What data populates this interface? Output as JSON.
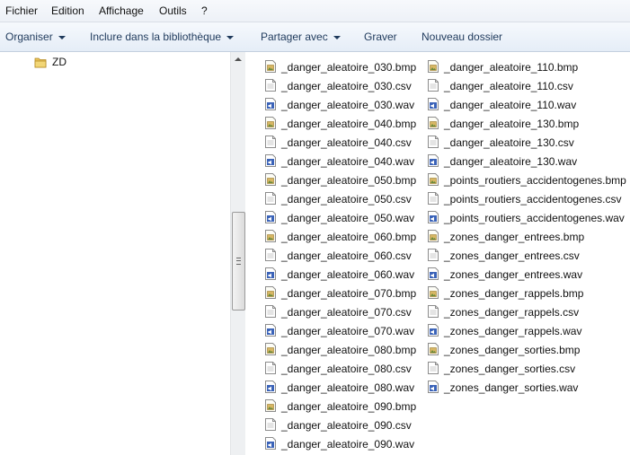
{
  "menubar": {
    "items": [
      "Fichier",
      "Edition",
      "Affichage",
      "Outils",
      "?"
    ]
  },
  "toolbar": {
    "organize": "Organiser",
    "include_library": "Inclure dans la bibliothèque",
    "share": "Partager avec",
    "burn": "Graver",
    "new_folder": "Nouveau dossier"
  },
  "nav": {
    "folder_label": "ZD"
  },
  "files": {
    "col1": [
      {
        "name": "_danger_aleatoire_030.bmp",
        "type": "bmp"
      },
      {
        "name": "_danger_aleatoire_030.csv",
        "type": "csv"
      },
      {
        "name": "_danger_aleatoire_030.wav",
        "type": "wav"
      },
      {
        "name": "_danger_aleatoire_040.bmp",
        "type": "bmp"
      },
      {
        "name": "_danger_aleatoire_040.csv",
        "type": "csv"
      },
      {
        "name": "_danger_aleatoire_040.wav",
        "type": "wav"
      },
      {
        "name": "_danger_aleatoire_050.bmp",
        "type": "bmp"
      },
      {
        "name": "_danger_aleatoire_050.csv",
        "type": "csv"
      },
      {
        "name": "_danger_aleatoire_050.wav",
        "type": "wav"
      },
      {
        "name": "_danger_aleatoire_060.bmp",
        "type": "bmp"
      },
      {
        "name": "_danger_aleatoire_060.csv",
        "type": "csv"
      },
      {
        "name": "_danger_aleatoire_060.wav",
        "type": "wav"
      },
      {
        "name": "_danger_aleatoire_070.bmp",
        "type": "bmp"
      },
      {
        "name": "_danger_aleatoire_070.csv",
        "type": "csv"
      },
      {
        "name": "_danger_aleatoire_070.wav",
        "type": "wav"
      },
      {
        "name": "_danger_aleatoire_080.bmp",
        "type": "bmp"
      },
      {
        "name": "_danger_aleatoire_080.csv",
        "type": "csv"
      },
      {
        "name": "_danger_aleatoire_080.wav",
        "type": "wav"
      },
      {
        "name": "_danger_aleatoire_090.bmp",
        "type": "bmp"
      },
      {
        "name": "_danger_aleatoire_090.csv",
        "type": "csv"
      },
      {
        "name": "_danger_aleatoire_090.wav",
        "type": "wav"
      }
    ],
    "col2": [
      {
        "name": "_danger_aleatoire_110.bmp",
        "type": "bmp"
      },
      {
        "name": "_danger_aleatoire_110.csv",
        "type": "csv"
      },
      {
        "name": "_danger_aleatoire_110.wav",
        "type": "wav"
      },
      {
        "name": "_danger_aleatoire_130.bmp",
        "type": "bmp"
      },
      {
        "name": "_danger_aleatoire_130.csv",
        "type": "csv"
      },
      {
        "name": "_danger_aleatoire_130.wav",
        "type": "wav"
      },
      {
        "name": "_points_routiers_accidentogenes.bmp",
        "type": "bmp"
      },
      {
        "name": "_points_routiers_accidentogenes.csv",
        "type": "csv"
      },
      {
        "name": "_points_routiers_accidentogenes.wav",
        "type": "wav"
      },
      {
        "name": "_zones_danger_entrees.bmp",
        "type": "bmp"
      },
      {
        "name": "_zones_danger_entrees.csv",
        "type": "csv"
      },
      {
        "name": "_zones_danger_entrees.wav",
        "type": "wav"
      },
      {
        "name": "_zones_danger_rappels.bmp",
        "type": "bmp"
      },
      {
        "name": "_zones_danger_rappels.csv",
        "type": "csv"
      },
      {
        "name": "_zones_danger_rappels.wav",
        "type": "wav"
      },
      {
        "name": "_zones_danger_sorties.bmp",
        "type": "bmp"
      },
      {
        "name": "_zones_danger_sorties.csv",
        "type": "csv"
      },
      {
        "name": "_zones_danger_sorties.wav",
        "type": "wav"
      }
    ]
  }
}
